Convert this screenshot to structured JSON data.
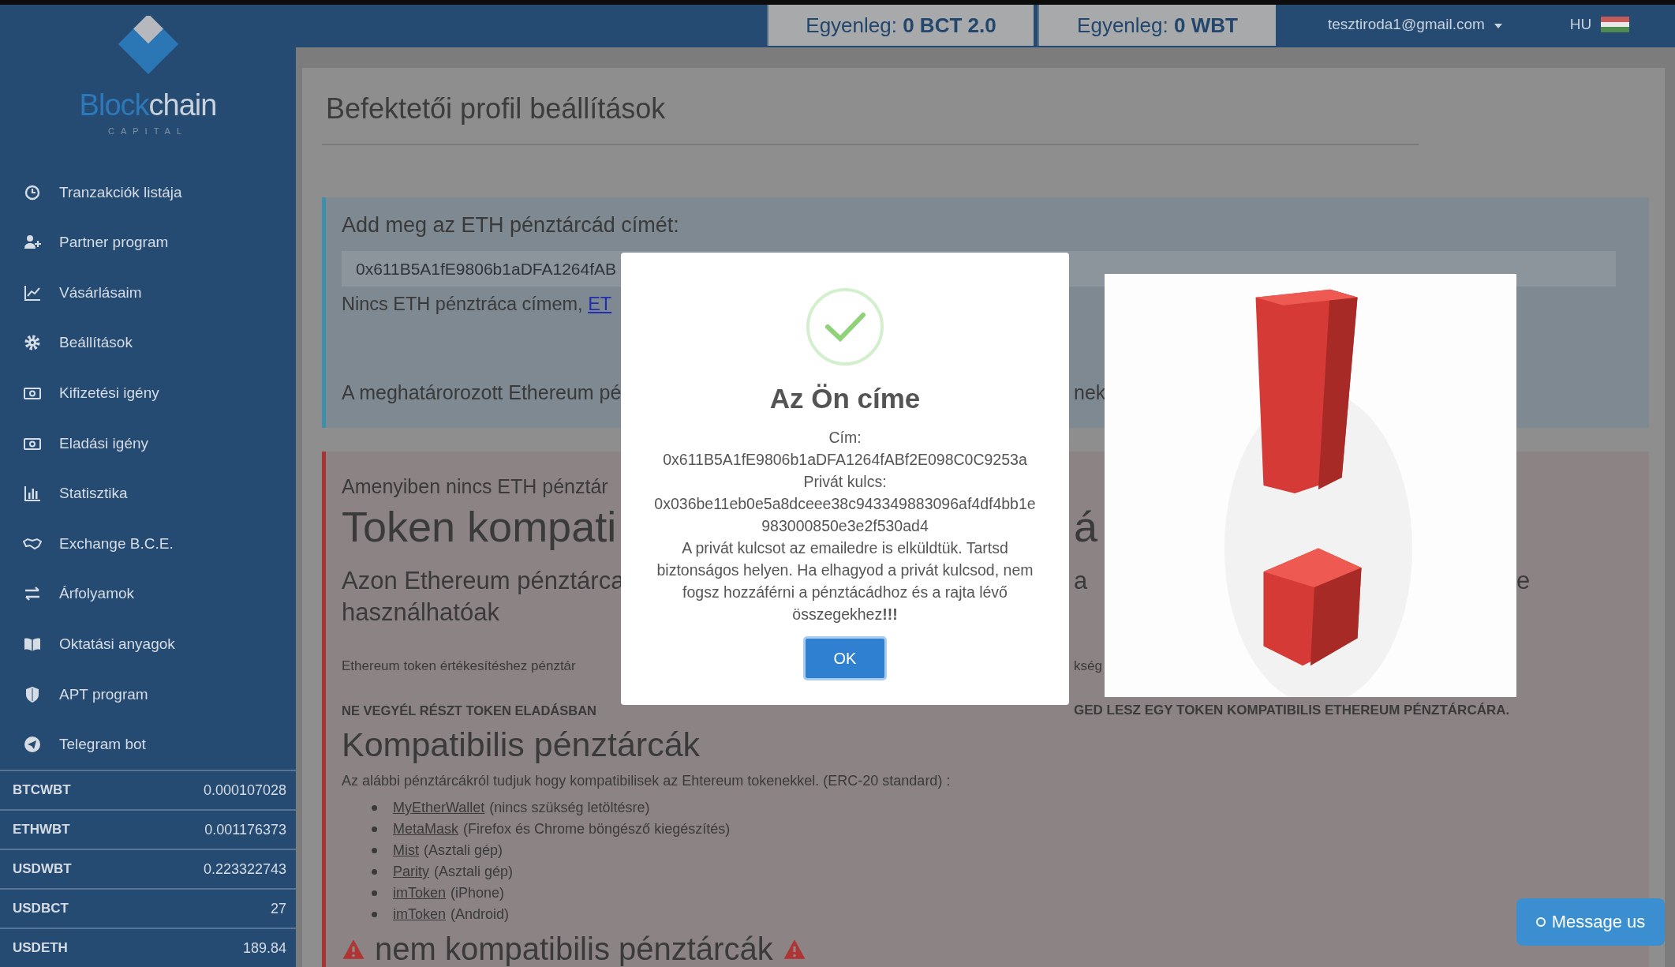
{
  "topbar": {
    "balances": [
      {
        "label": "Egyenleg:",
        "amount": "0 BCT 2.0"
      },
      {
        "label": "Egyenleg:",
        "amount": "0 WBT"
      }
    ],
    "account": "tesztiroda1@gmail.com",
    "language": "HU"
  },
  "sidebar": {
    "logo": {
      "parts": [
        "Block",
        "chain"
      ],
      "tagline": "CAPITAL"
    },
    "items": [
      "Tranzakciók listája",
      "Partner program",
      "Vásárlásaim",
      "Beállítások",
      "Kifizetési igény",
      "Eladási igény",
      "Statisztika",
      "Exchange B.C.E.",
      "Árfolyamok",
      "Oktatási anyagok",
      "APT program",
      "Telegram bot"
    ],
    "rates": [
      {
        "pair": "BTCWBT",
        "value": "0.000107028"
      },
      {
        "pair": "ETHWBT",
        "value": "0.001176373"
      },
      {
        "pair": "USDWBT",
        "value": "0.223322743"
      },
      {
        "pair": "USDBCT",
        "value": "27"
      },
      {
        "pair": "USDETH",
        "value": "189.84"
      }
    ]
  },
  "page": {
    "title": "Befektetői profil beállítások",
    "address_box": {
      "label": "Add meg az ETH pénztárcád címét:",
      "value": "0x611B5A1fE9806b1aDFA1264fAB",
      "no_wallet_text": "Nincs ETH pénztráca címem,",
      "no_wallet_link": "ET",
      "note_left": "A meghatárorozott Ethereum pé",
      "note_right": "nek"
    },
    "token_box": {
      "intro": "Amenyiben nincs ETH pénztár",
      "heading_left": "Token kompati",
      "heading_right": "á",
      "subtitle_left": "Azon Ethereum pénztárca",
      "subtitle_middle": "a",
      "subtitle_right": "e",
      "subtitle_line2": "használhatóak",
      "info_left": "Ethereum token értékesítéshez pénztár",
      "info_right": "kség",
      "warning_left": "NE VEGYÉL RÉSZT TOKEN ELADÁSBAN",
      "warning_right": "GED LESZ EGY TOKEN KOMPATIBILIS ETHEREUM PÉNZTÁRCÁRA.",
      "compatible_heading": "Kompatibilis pénztárcák",
      "compatible_intro": "Az alábbi pénztárcákról tudjuk hogy kompatibilisek az Ehtereum tokenekkel. (ERC-20 standard) :",
      "wallets": [
        {
          "name": "MyEtherWallet",
          "note": "(nincs szükség letöltésre)"
        },
        {
          "name": "MetaMask",
          "note": "(Firefox és Chrome böngésző kiegészítés)"
        },
        {
          "name": "Mist",
          "note": "(Asztali gép)"
        },
        {
          "name": "Parity",
          "note": "(Asztali gép)"
        },
        {
          "name": "imToken",
          "note": "(iPhone)"
        },
        {
          "name": "imToken",
          "note": "(Android)"
        }
      ],
      "incompatible_heading": "nem kompatibilis pénztárcák"
    }
  },
  "modal": {
    "title": "Az Ön címe",
    "lines": [
      "Cím:",
      "0x611B5A1fE9806b1aDFA1264fABf2E098C0C9253a",
      "Privát kulcs:",
      "0x036be11eb0e5a8dceee38c943349883096af4df4bb1e983000850e3e2f530ad4",
      "A privát kulcsot az emailedre is elküldtük. Tartsd biztonságos helyen. Ha elhagyod a privát kulcsod, nem fogsz hozzáférni a pénztácádhoz és a rajta lévő összegekhez**!!!**"
    ],
    "button": "OK"
  },
  "chat_button": "Message us"
}
